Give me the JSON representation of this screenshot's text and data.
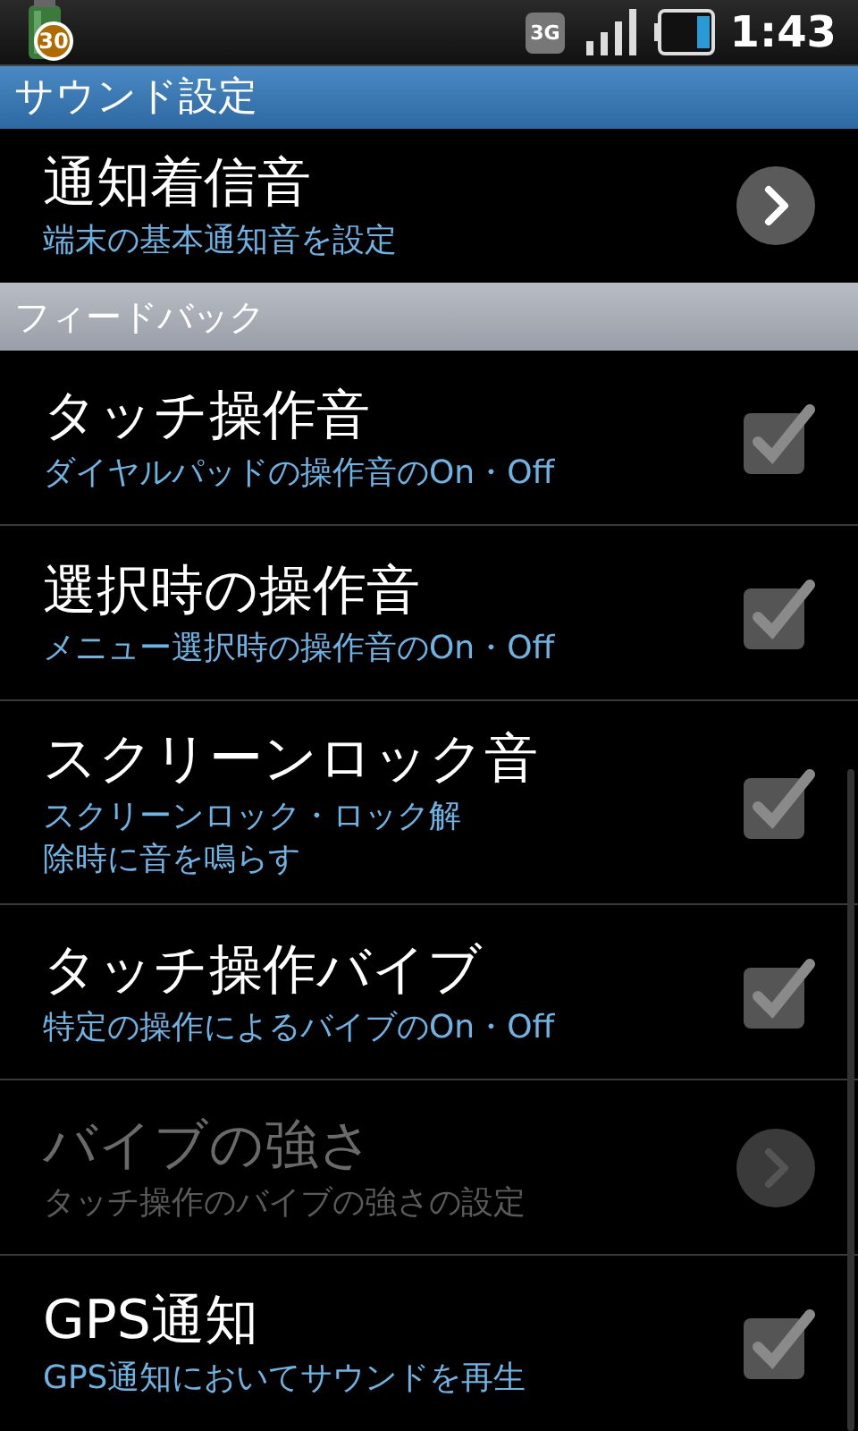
{
  "status_bar": {
    "app_badge": "30",
    "network_type": "3G",
    "time": "1:43"
  },
  "title": "サウンド設定",
  "sections": [
    {
      "items": [
        {
          "kind": "link",
          "title": "通知着信音",
          "summary": "端末の基本通知音を設定",
          "disabled": false
        }
      ]
    },
    {
      "header": "フィードバック",
      "items": [
        {
          "kind": "checkbox",
          "title": "タッチ操作音",
          "summary": "ダイヤルパッドの操作音のOn・Off",
          "checked": true,
          "disabled": false
        },
        {
          "kind": "checkbox",
          "title": "選択時の操作音",
          "summary": "メニュー選択時の操作音のOn・Off",
          "checked": true,
          "disabled": false
        },
        {
          "kind": "checkbox",
          "title": "スクリーンロック音",
          "summary_lines": [
            "スクリーンロック・ロック解",
            "除時に音を鳴らす"
          ],
          "checked": true,
          "disabled": false
        },
        {
          "kind": "checkbox",
          "title": "タッチ操作バイブ",
          "summary": "特定の操作によるバイブのOn・Off",
          "checked": true,
          "disabled": false
        },
        {
          "kind": "link",
          "title": "バイブの強さ",
          "summary": "タッチ操作のバイブの強さの設定",
          "disabled": true
        },
        {
          "kind": "checkbox",
          "title": "GPS通知",
          "summary": "GPS通知においてサウンドを再生",
          "checked": true,
          "disabled": false
        }
      ]
    }
  ]
}
